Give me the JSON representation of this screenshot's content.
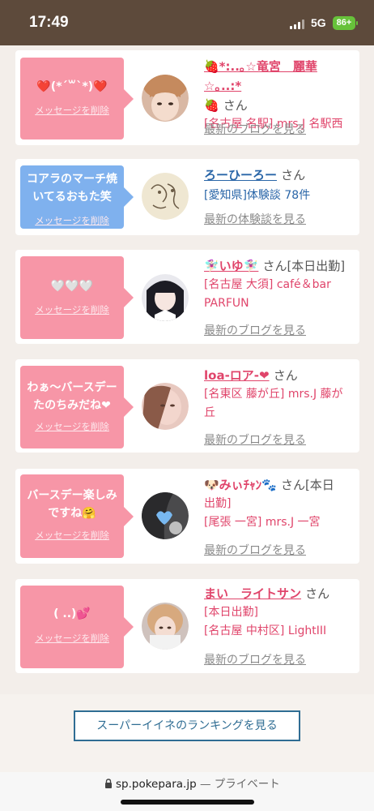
{
  "status_bar": {
    "time": "17:49",
    "network": "5G",
    "battery": "86+"
  },
  "colors": {
    "pink_bubble": "#f796a7",
    "blue_bubble": "#7fb1ee",
    "name_pink": "#e0456b",
    "name_blue": "#2a66a8"
  },
  "messages": [
    {
      "text": "❤️(*´꒳`*)❤️",
      "delete": "メッセージを削除",
      "name": "🍓*:..｡☆竜宮　麗華☆｡..:*",
      "name2": "🍓",
      "san": "さん",
      "line1": "[名古屋 名駅] mrs.J 名駅西",
      "blog": "最新のブログを見る"
    },
    {
      "text": "コアラのマーチ焼いてるおもた笑",
      "delete": "メッセージを削除",
      "name": "ろーひーろー",
      "san": "さん",
      "line1": "[愛知県]体験談 78件",
      "blog": "最新の体験談を見る"
    },
    {
      "text": "🤍🤍🤍",
      "delete": "メッセージを削除",
      "name": "🧚🏻‍♀️いゆ🧚🏻‍♀️",
      "san": "さん[本日出勤]",
      "line1": "[名古屋 大須] café＆bar",
      "line2": "PARFUN",
      "blog": "最新のブログを見る"
    },
    {
      "text": "わぁ～バースデーたのちみだね❤",
      "delete": "メッセージを削除",
      "name": "loa-ロア-❤",
      "san": "さん",
      "line1": "[名東区 藤が丘] mrs.J 藤が",
      "line2": "丘",
      "blog": "最新のブログを見る"
    },
    {
      "text": "バースデー楽しみですね🤗",
      "delete": "メッセージを削除",
      "name": "🐶みぃﾁｬﾝ🐾",
      "san": "さん[本日",
      "line1": "出勤]",
      "line2": "[尾張 一宮] mrs.J 一宮",
      "blog": "最新のブログを見る"
    },
    {
      "text": "( ..)💕",
      "delete": "メッセージを削除",
      "name": "まい　ライトサン",
      "san": "さん",
      "line1": "[本日出勤]",
      "line2": "[名古屋 中村区] LightIII",
      "blog": "最新のブログを見る"
    }
  ],
  "ranking_button": "スーパーイイネのランキングを見る",
  "url_bar": {
    "domain": "sp.pokepara.jp",
    "suffix": "— プライベート"
  }
}
